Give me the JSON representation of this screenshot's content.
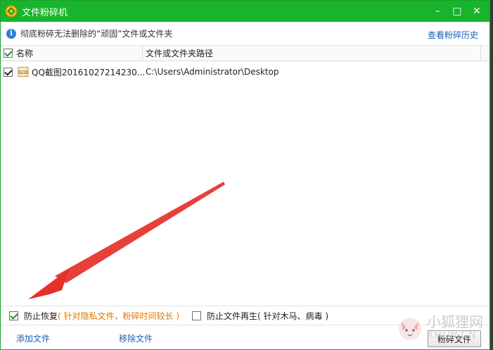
{
  "window": {
    "title": "文件粉碎机",
    "controls": {
      "minimize": "–",
      "maximize": "□",
      "close": "✕"
    }
  },
  "info": {
    "text": "彻底粉碎无法删除的“顽固”文件或文件夹",
    "history_link": "查看粉碎历史"
  },
  "table": {
    "columns": [
      "名称",
      "文件或文件夹路径"
    ],
    "rows": [
      {
        "name": "QQ截图20161027214230....",
        "path": "C:\\Users\\Administrator\\Desktop",
        "checked": true
      }
    ]
  },
  "options": {
    "prevent_recovery": {
      "label": "防止恢复",
      "note": "( 针对隐私文件，粉碎时间较长 )",
      "checked": true
    },
    "prevent_regen": {
      "label": "防止文件再生",
      "note": "( 针对木马、病毒 )",
      "checked": false
    }
  },
  "footer": {
    "add_file": "添加文件",
    "remove_file": "移除文件",
    "shred_button": "粉碎文件"
  },
  "watermark": {
    "line1": "小狐狸网",
    "line2": "XHLW.CN"
  },
  "colors": {
    "titlebar": "#18b52c",
    "link": "#1a5fb4",
    "note": "#e07800",
    "arrow": "#e5302a"
  }
}
